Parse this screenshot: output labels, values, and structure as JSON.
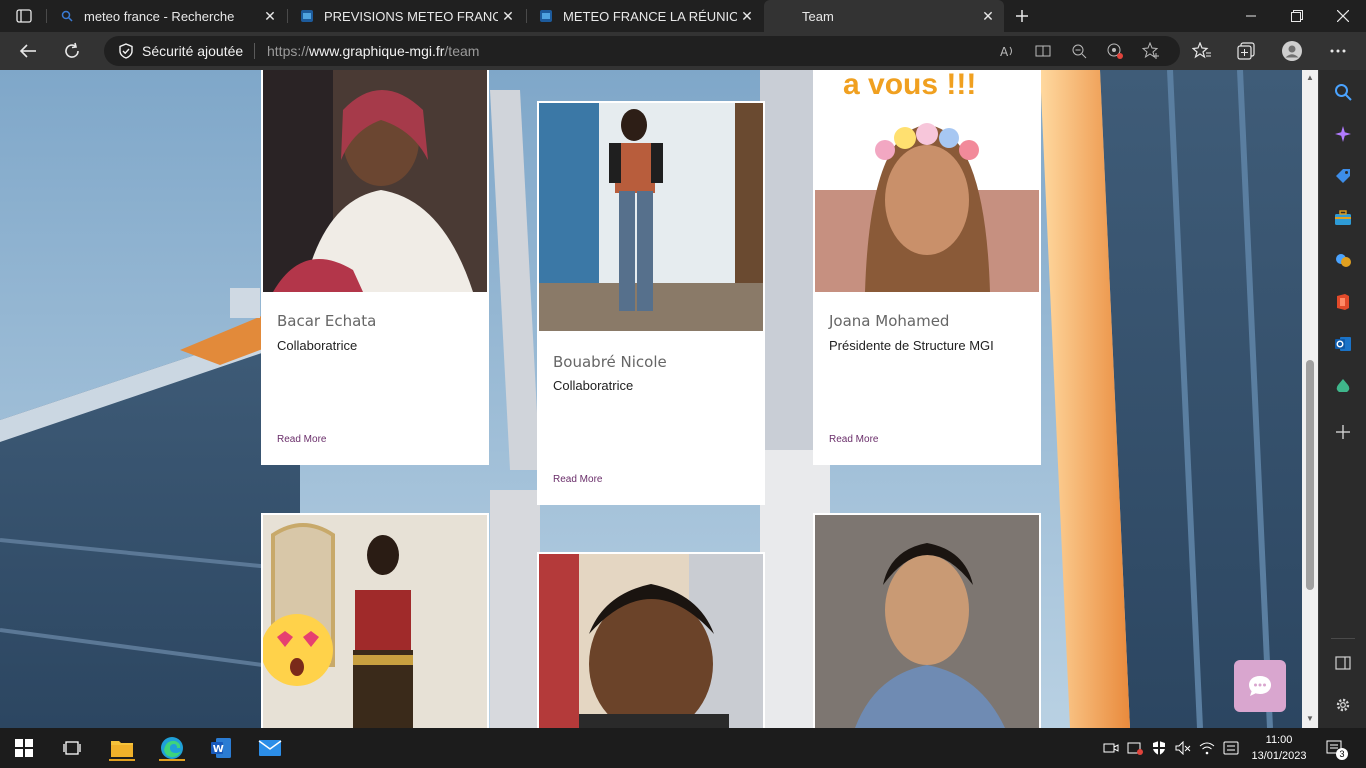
{
  "tabs": [
    {
      "title": "meteo france - Recherche",
      "close": "✕"
    },
    {
      "title": "PREVISIONS METEO FRANCE - Si",
      "close": "✕"
    },
    {
      "title": "METEO FRANCE LA RÉUNION pa",
      "close": "✕"
    },
    {
      "title": "Team",
      "close": "✕"
    }
  ],
  "omnibox": {
    "security": "Sécurité ajoutée",
    "url_scheme": "https://",
    "url_host": "www.graphique-mgi.fr",
    "url_path": "/team"
  },
  "team": {
    "members": [
      {
        "name": "Bacar Echata",
        "role": "Collaboratrice",
        "more": "Read More"
      },
      {
        "name": "Bouabré Nicole",
        "role": "Collaboratrice",
        "more": "Read More"
      },
      {
        "name": "Joana Mohamed",
        "role": "Présidente de Structure MGI",
        "more": "Read More"
      }
    ],
    "banner_text": "a vous !!!"
  },
  "taskbar": {
    "time": "11:00",
    "date": "13/01/2023",
    "notifications": "3"
  },
  "colors": {
    "accent": "#6a2e6a",
    "chat": "#d9a6cf",
    "browser_dark": "#202020"
  }
}
